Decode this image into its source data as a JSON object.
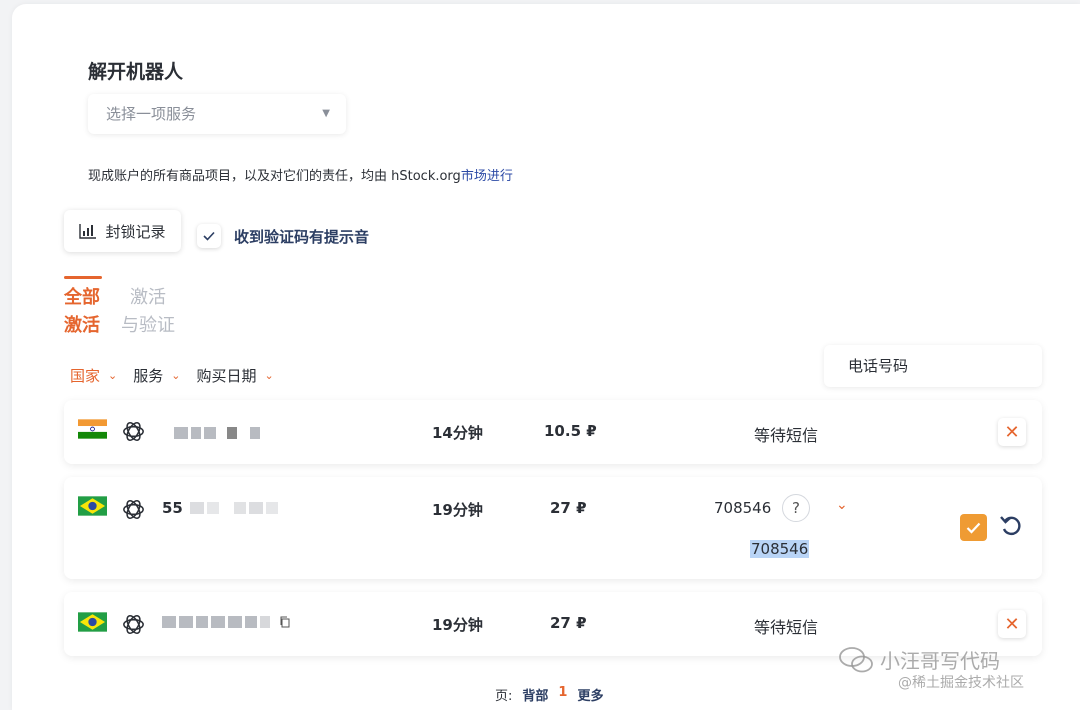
{
  "title": "解开机器人",
  "service_select": {
    "placeholder": "选择一项服务"
  },
  "notice": {
    "text": "现成账户的所有商品项目，以及对它们的责任，均由 hStock.org",
    "link": "市场进行"
  },
  "block_log_button": "封锁记录",
  "sound_checkbox": {
    "label": "收到验证码有提示音",
    "checked": true
  },
  "tabs": [
    {
      "line1": "全部",
      "line2": "激活",
      "active": true
    },
    {
      "line1": "激活",
      "line2": "与验证",
      "active": false
    }
  ],
  "filters": [
    {
      "label": "国家",
      "active": true
    },
    {
      "label": "服务",
      "active": false
    },
    {
      "label": "购买日期",
      "active": false
    }
  ],
  "phone_field": {
    "label": "电话号码"
  },
  "orders": [
    {
      "country": "India",
      "service_icon": "openai-icon",
      "phone_visible": "",
      "time": "14分钟",
      "price": "10.5 ₽",
      "status": "等待短信",
      "action": "cancel"
    },
    {
      "country": "Brazil",
      "service_icon": "openai-icon",
      "phone_visible": "55",
      "time": "19分钟",
      "price": "27 ₽",
      "code": "708546",
      "code_selected": "708546",
      "action": "confirm"
    },
    {
      "country": "Brazil",
      "service_icon": "openai-icon",
      "phone_visible": "",
      "time": "19分钟",
      "price": "27 ₽",
      "status": "等待短信",
      "action": "cancel"
    }
  ],
  "pagination": {
    "label": "页:",
    "prev": "背部",
    "current": "1",
    "next": "更多"
  },
  "watermark": {
    "line1": "小汪哥写代码",
    "line2": "@稀土掘金技术社区"
  },
  "colors": {
    "accent": "#e5652e",
    "confirm": "#ef9b33",
    "link": "#2c4aa6"
  }
}
